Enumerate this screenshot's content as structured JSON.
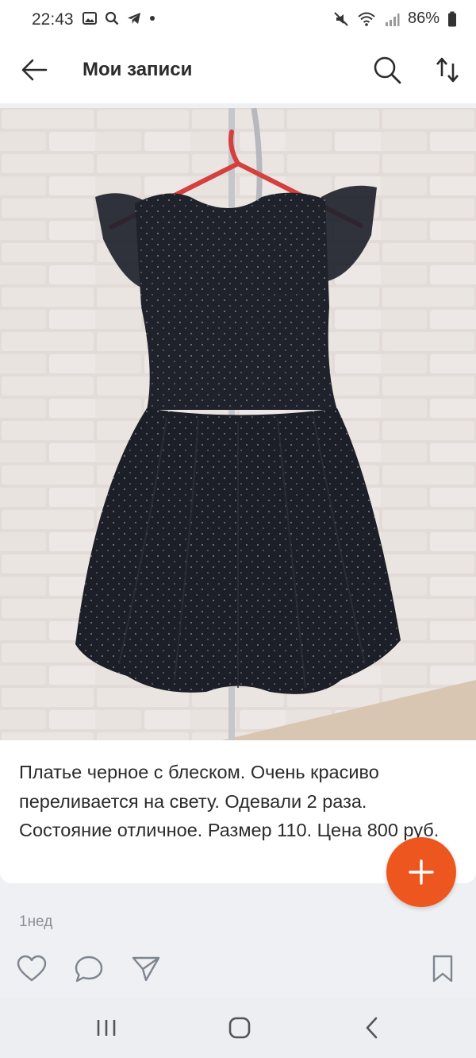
{
  "status_bar": {
    "time": "22:43",
    "battery": "86%",
    "left_icons": [
      "gallery-icon",
      "search-icon",
      "telegram-icon",
      "dot-icon"
    ],
    "right_icons": [
      "mute-icon",
      "wifi-icon",
      "signal-icon",
      "battery-icon"
    ]
  },
  "header": {
    "title": "Мои записи",
    "back_icon": "arrow-left-icon",
    "search_icon": "search-icon",
    "sort_icon": "sort-arrows-icon"
  },
  "post": {
    "image_alt": "black-sparkle-dress-photo",
    "text": "Платье черное с блеском. Очень красиво переливается на свету. Одевали 2 раза. Состояние отличное. Размер 110. Цена 800 руб.",
    "time_ago": "1нед"
  },
  "actions": {
    "like_icon": "heart-icon",
    "comment_icon": "comment-icon",
    "share_icon": "share-icon",
    "bookmark_icon": "bookmark-icon"
  },
  "fab": {
    "icon": "plus-icon",
    "color": "#ee5620"
  },
  "navbar": {
    "icons": [
      "recents-icon",
      "home-icon",
      "back-icon"
    ]
  }
}
